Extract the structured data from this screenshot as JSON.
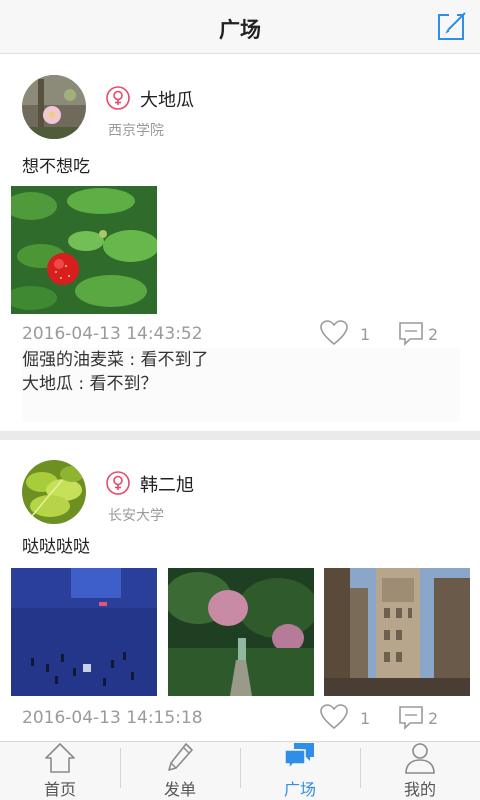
{
  "header": {
    "title": "广场",
    "compose_icon": "compose-icon"
  },
  "posts": [
    {
      "username": "大地瓜",
      "school": "西京学院",
      "content": "想不想吃",
      "time": "2016-04-13 14:43:52",
      "likes": "1",
      "comments_count": "2",
      "comments": [
        "倔强的油麦菜 : 看不到了",
        "大地瓜 : 看不到？"
      ]
    },
    {
      "username": "韩二旭",
      "school": "长安大学",
      "content": "哒哒哒哒",
      "time": "2016-04-13 14:15:18",
      "likes": "1",
      "comments_count": "2"
    }
  ],
  "tabs": [
    {
      "label": "首页",
      "icon": "home-icon"
    },
    {
      "label": "发单",
      "icon": "pencil-icon"
    },
    {
      "label": "广场",
      "icon": "chat-bubbles-icon"
    },
    {
      "label": "我的",
      "icon": "person-icon"
    }
  ],
  "colors": {
    "accent": "#2f8fe8",
    "female": "#e8496a",
    "muted": "#9a9a9a"
  }
}
